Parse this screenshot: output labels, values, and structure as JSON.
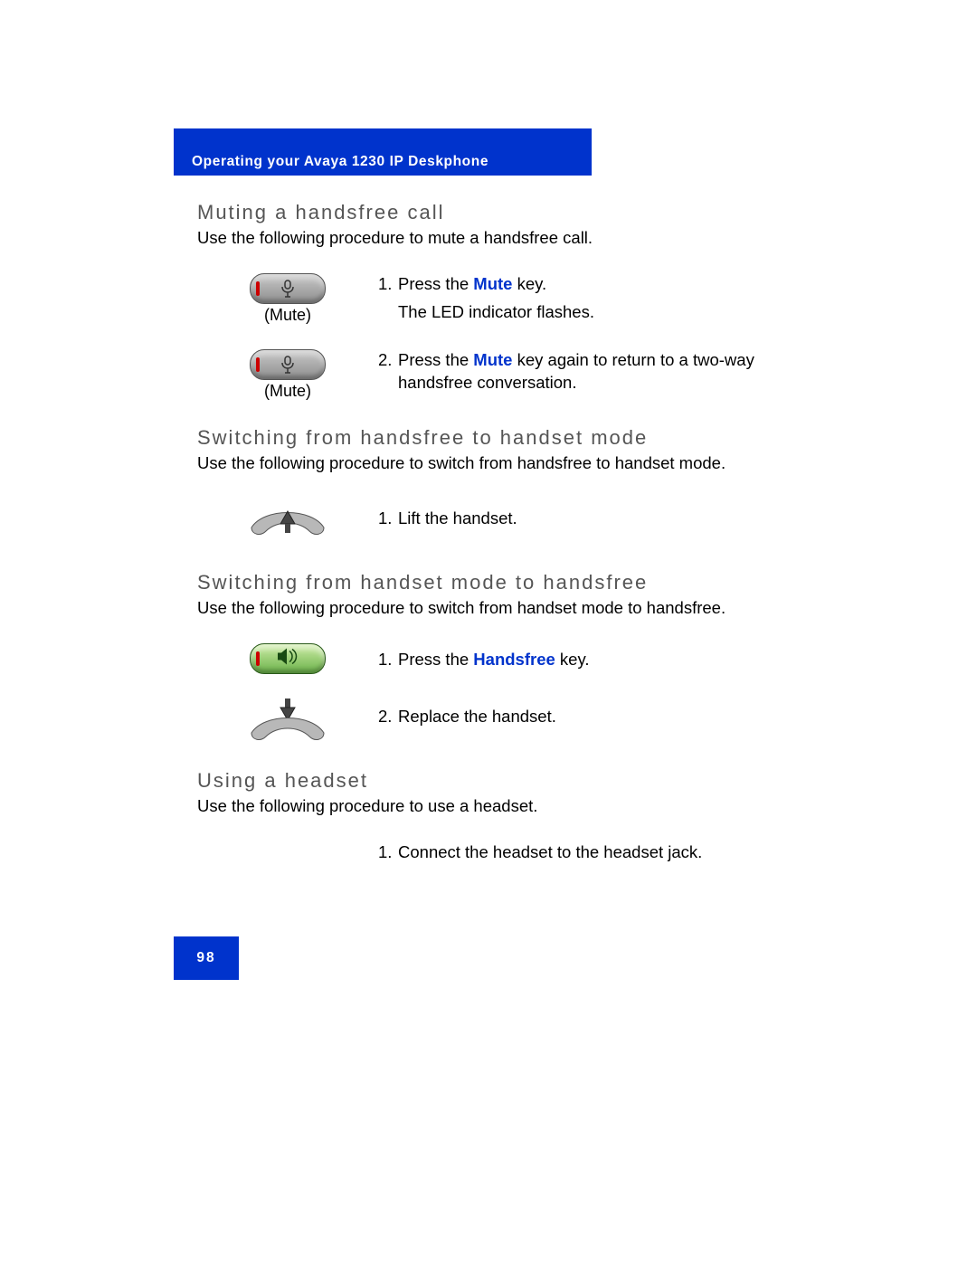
{
  "header": {
    "title": "Operating your Avaya 1230 IP Deskphone"
  },
  "footer": {
    "page_number": "98"
  },
  "sections": {
    "mute": {
      "heading": "Muting a handsfree call",
      "intro": "Use the following procedure to mute a handsfree call.",
      "icon_label": "(Mute)",
      "step1": {
        "num": "1.",
        "prefix": "Press the ",
        "key": "Mute",
        "suffix": " key.",
        "line2": "The LED indicator flashes."
      },
      "step2": {
        "num": "2.",
        "prefix": "Press the ",
        "key": "Mute",
        "suffix": " key again to return to a two-way handsfree conversation."
      }
    },
    "hf_to_hs": {
      "heading": "Switching from handsfree to handset mode",
      "intro": "Use the following procedure to switch from handsfree to handset mode.",
      "step1": {
        "num": "1.",
        "text": "Lift the handset."
      }
    },
    "hs_to_hf": {
      "heading": "Switching from handset mode to handsfree",
      "intro": "Use the following procedure to switch from handset mode to handsfree.",
      "step1": {
        "num": "1.",
        "prefix": "Press the ",
        "key": "Handsfree",
        "suffix": " key."
      },
      "step2": {
        "num": "2.",
        "text": "Replace the handset."
      }
    },
    "headset": {
      "heading": "Using a headset",
      "intro": "Use the following procedure to use a headset.",
      "step1": {
        "num": "1.",
        "text": "Connect the headset to the headset jack."
      }
    }
  }
}
